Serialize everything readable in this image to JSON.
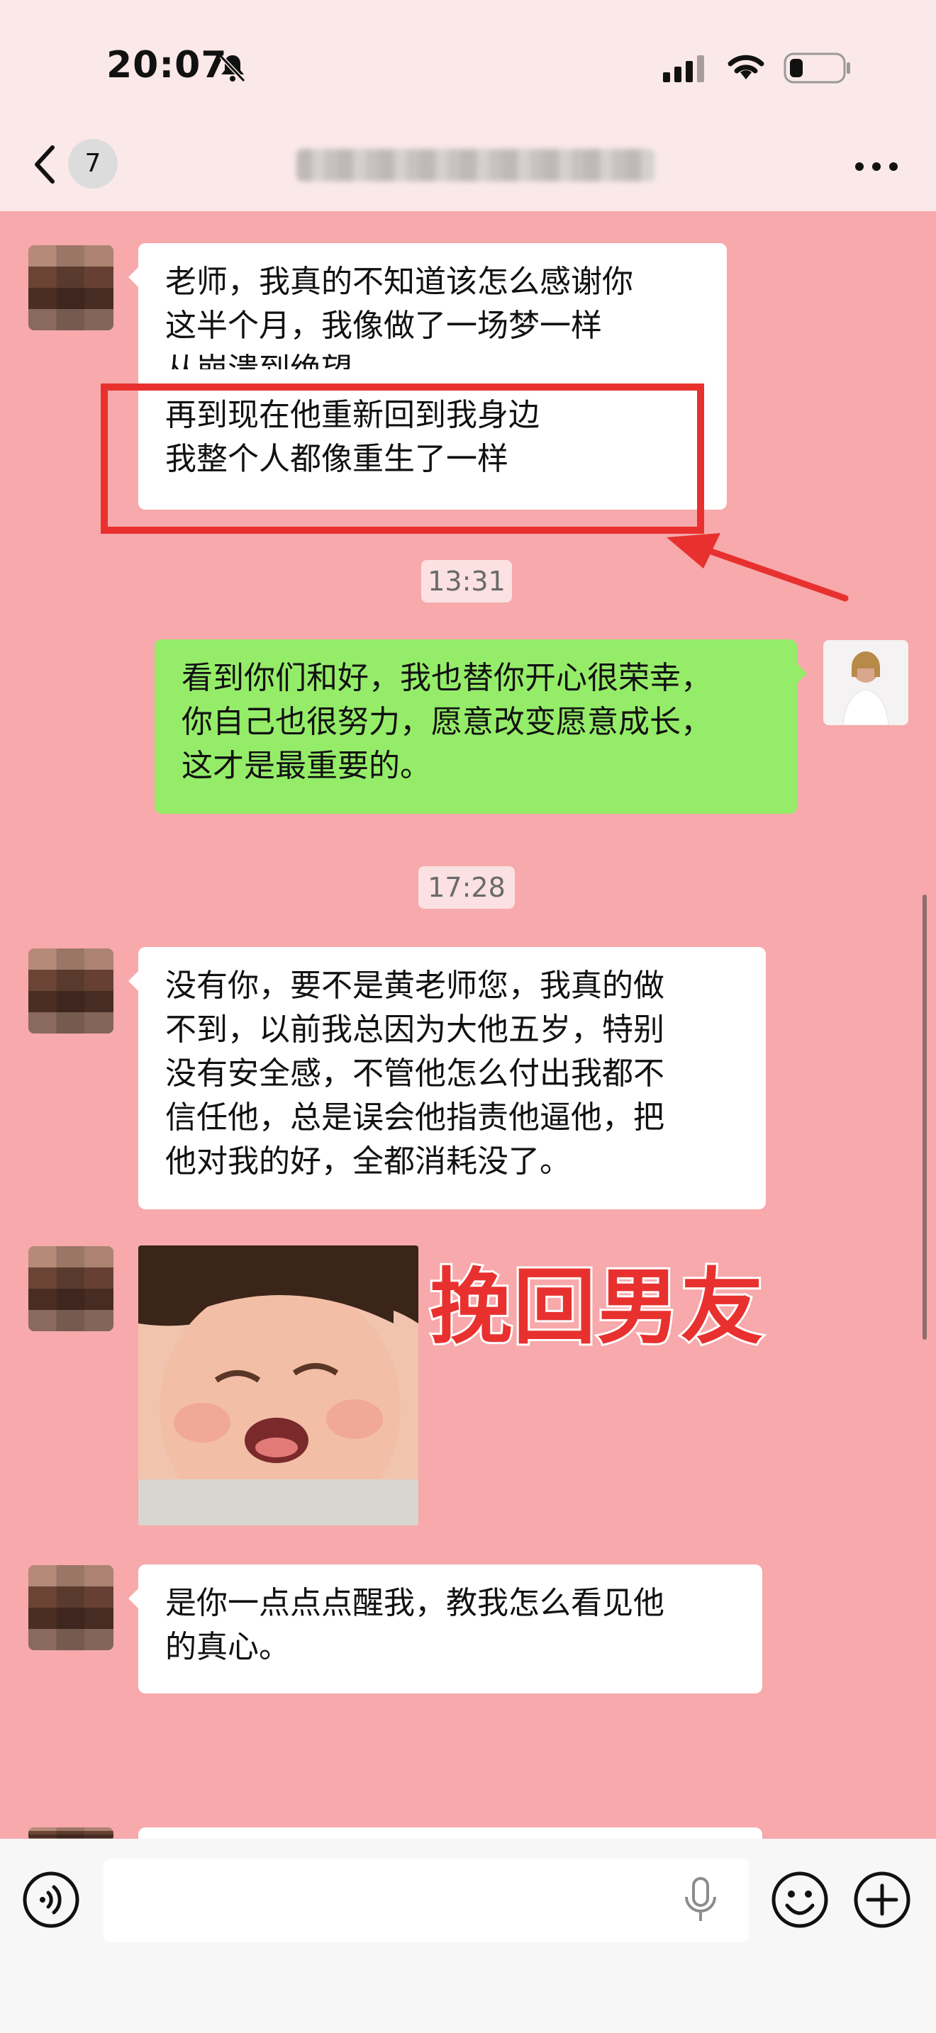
{
  "status_bar": {
    "time": "20:07"
  },
  "nav": {
    "back_count": "7",
    "title": ""
  },
  "messages": [
    {
      "side": "left",
      "lines": [
        "老师，我真的不知道该怎么感谢你",
        "这半个月，我像做了一场梦一样",
        "从崩溃到绝望",
        "再到现在他重新回到我身边",
        "我整个人都像重生了一样"
      ]
    },
    {
      "time": "13:31"
    },
    {
      "side": "right",
      "lines": [
        "看到你们和好，我也替你开心很荣幸，",
        "你自己也很努力，愿意改变愿意成长，",
        "这才是最重要的。"
      ]
    },
    {
      "time": "17:28"
    },
    {
      "side": "left",
      "lines": [
        "没有你，要不是黄老师您，我真的做",
        "不到，以前我总因为大他五岁，特别",
        "没有安全感，不管他怎么付出我都不",
        "信任他，总是误会他指责他逼他，把",
        "他对我的好，全都消耗没了。"
      ]
    },
    {
      "side": "left",
      "sticker": "crying-child-sticker"
    },
    {
      "side": "left",
      "lines": [
        "是你一点点点醒我，教我怎么看见他",
        "的真心。"
      ]
    }
  ],
  "overlay": {
    "headline": "挽回男友"
  },
  "colors": {
    "chat_bg": "#f7a9ab",
    "green_bubble": "#95ec69",
    "highlight": "#e8312f"
  },
  "icons": [
    "bell-slash-icon",
    "signal-icon",
    "wifi-icon",
    "battery-icon",
    "back-chevron-icon",
    "more-icon",
    "voice-icon",
    "mic-icon",
    "emoji-icon",
    "plus-icon"
  ]
}
